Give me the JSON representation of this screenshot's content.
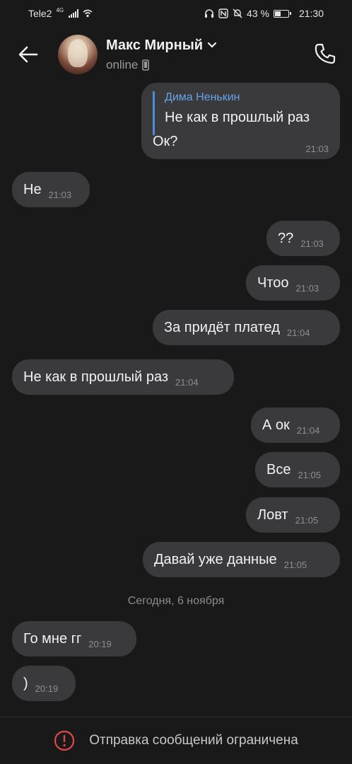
{
  "status_bar": {
    "carrier": "Tele2",
    "network": "4G",
    "battery": "43 %",
    "time": "21:30"
  },
  "header": {
    "contact_name": "Макс Мирный",
    "status": "online"
  },
  "messages": [
    {
      "side": "out",
      "reply_to": {
        "author": "Дима Ненькин",
        "text": "Не как в прошлый раз"
      },
      "text": "Ок?",
      "time": "21:03"
    },
    {
      "side": "in",
      "text": "Не",
      "time": "21:03"
    },
    {
      "side": "out",
      "text": "??",
      "time": "21:03"
    },
    {
      "side": "out",
      "text": "Чтоо",
      "time": "21:03"
    },
    {
      "side": "out",
      "text": "За придёт платед",
      "time": "21:04"
    },
    {
      "side": "in",
      "text": "Не как в прошлый раз",
      "time": "21:04"
    },
    {
      "side": "out",
      "text": "А ок",
      "time": "21:04"
    },
    {
      "side": "out",
      "text": "Все",
      "time": "21:05"
    },
    {
      "side": "out",
      "text": "Ловт",
      "time": "21:05"
    },
    {
      "side": "out",
      "text": "Давай уже данные",
      "time": "21:05"
    },
    {
      "side": "in",
      "text": "Го мне гг",
      "time": "20:19"
    },
    {
      "side": "in",
      "text": ")",
      "time": "20:19"
    }
  ],
  "date_separator": "Сегодня, 6 ноября",
  "footer": {
    "notice": "Отправка сообщений ограничена"
  },
  "colors": {
    "background": "#19191a",
    "bubble": "#3a3a3c",
    "quote_accent": "#4a90d9",
    "warning": "#e0474c"
  }
}
